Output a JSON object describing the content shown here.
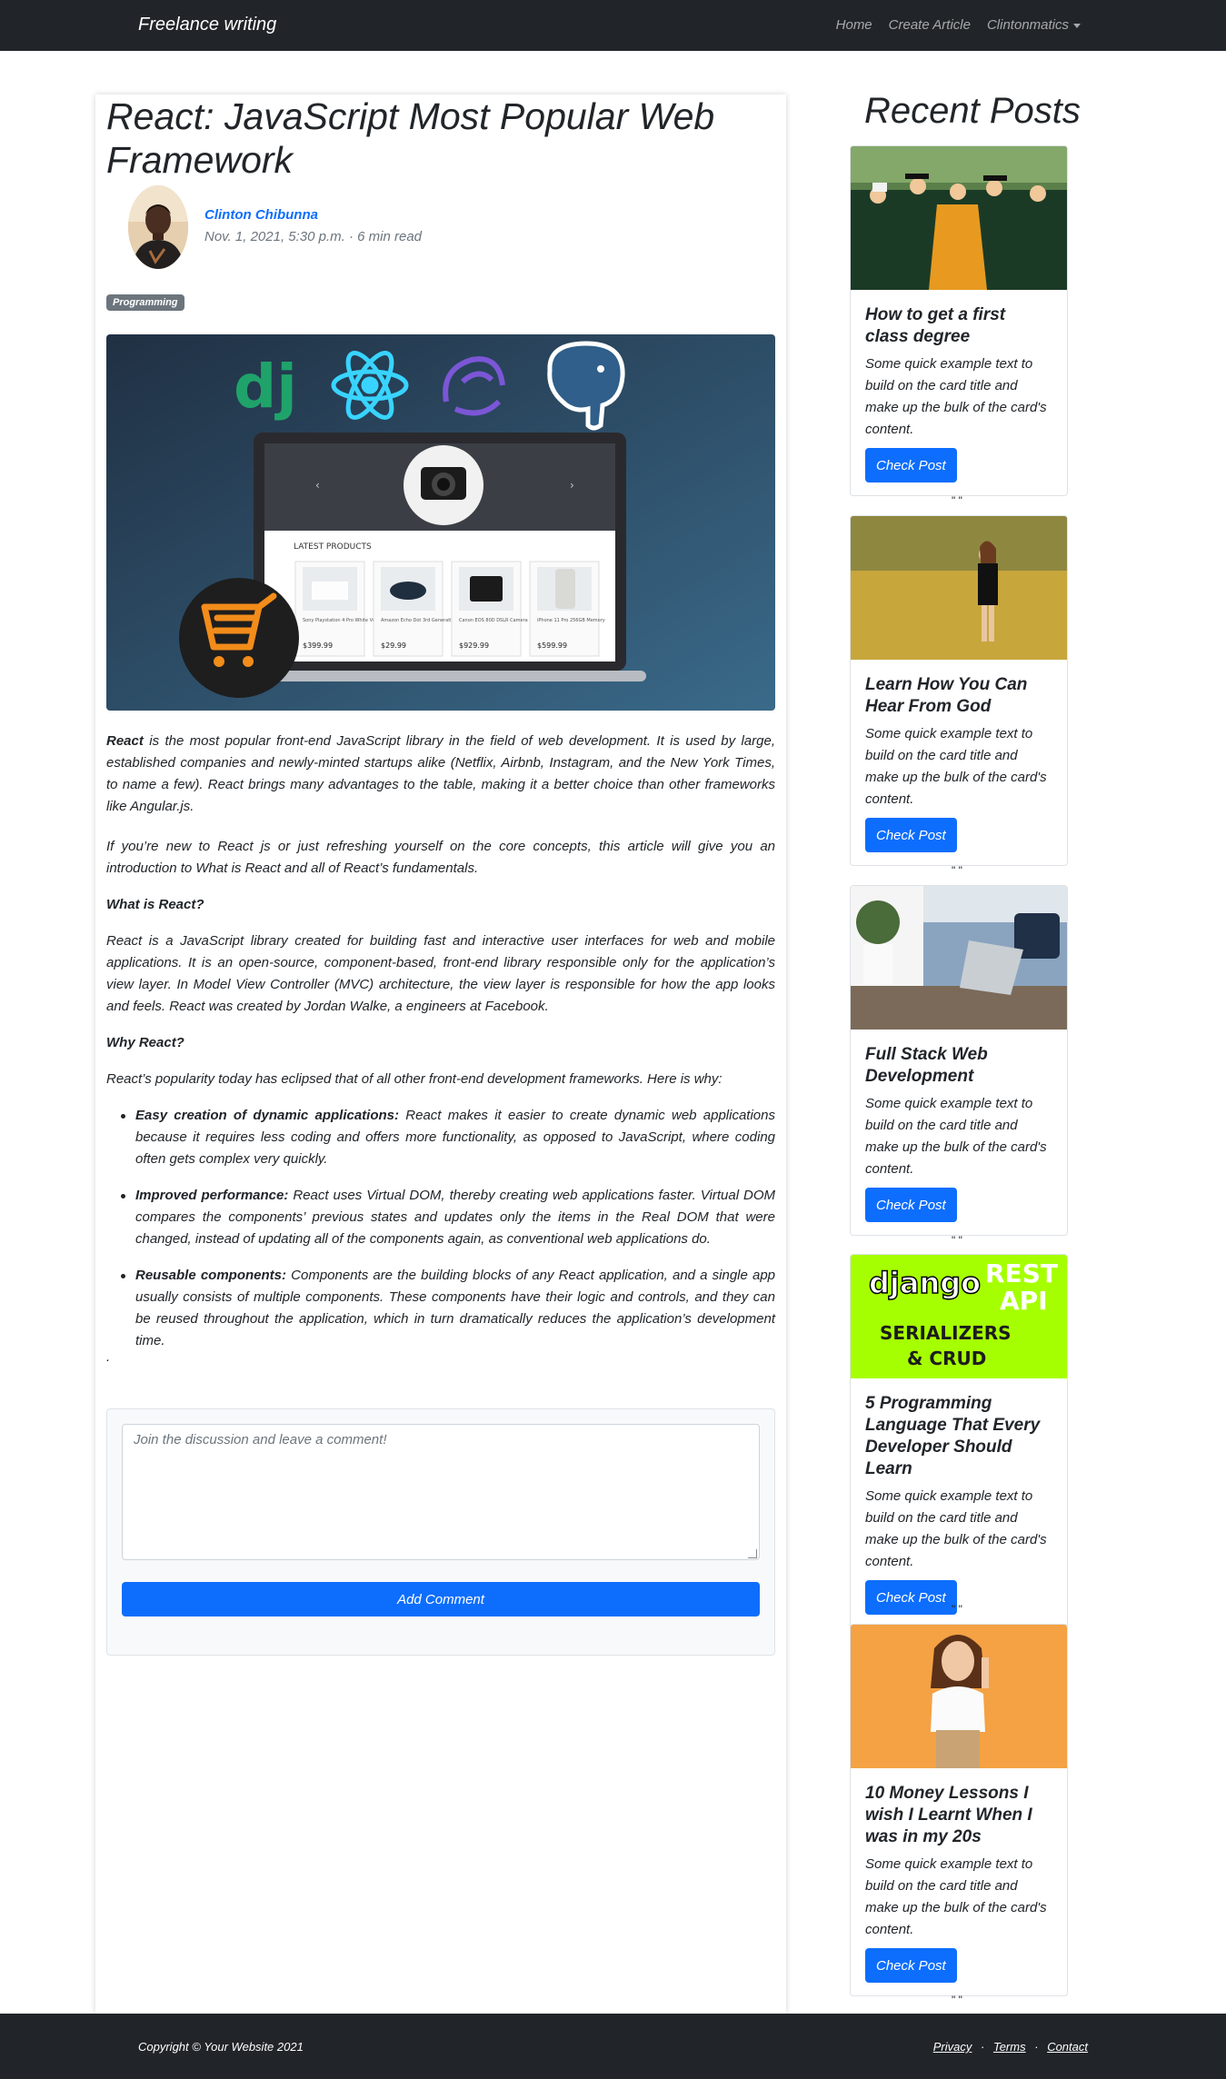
{
  "nav": {
    "brand": "Freelance writing",
    "links": [
      "Home",
      "Create Article",
      "Clintonmatics"
    ]
  },
  "article": {
    "title": "React: JavaScript Most Popular Web Framework",
    "author": "Clinton Chibunna",
    "meta": "Nov. 1, 2021, 5:30 p.m. · 6 min read",
    "category": "Programming",
    "p1_lead": "React",
    "p1_rest": " is the most popular front-end JavaScript library in the field of web development. It is used by large, established companies and newly-minted startups alike (Netflix, Airbnb, Instagram, and the New York Times, to name a few). React brings many advantages to the table, making it a better choice than other frameworks like Angular.js.",
    "p2": "If you’re new to React js or just refreshing yourself on the core concepts, this article will give you an introduction to What is React and all of React’s fundamentals.",
    "h_what": "What is React?",
    "p3": "React is a JavaScript library created for building fast and interactive user interfaces for web and mobile applications. It is an open-source, component-based, front-end library responsible only for the application’s view layer. In Model View Controller (MVC) architecture, the view layer is responsible for how the app looks and feels. React was created by Jordan Walke, a engineers  at Facebook.",
    "h_why": "Why React?",
    "p4": "React’s popularity today has eclipsed that of all other front-end development frameworks. Here is why:",
    "list": [
      {
        "lead": "Easy creation of dynamic applications:",
        "text": " React makes it easier to create dynamic web applications because it requires less coding and offers more functionality, as opposed to JavaScript, where coding often gets complex very quickly."
      },
      {
        "lead": "Improved performance:",
        "text": " React uses Virtual DOM, thereby creating web applications faster. Virtual DOM compares the components’ previous states and updates only the items in the Real DOM that were changed, instead of updating all of the components again, as conventional web applications do."
      },
      {
        "lead": "Reusable components:",
        "text": " Components are the building blocks of any React application, and a single app usually consists of multiple components. These components have their logic and controls, and they can be reused throughout the application, which in turn dramatically reduces the application’s development time."
      }
    ],
    "trailing_dot": "."
  },
  "hero_image": {
    "section_label": "LATEST PRODUCTS",
    "products": [
      {
        "name": "Sony Playstation 4 Pro White Version",
        "price": "$399.99"
      },
      {
        "name": "Amazon Echo Dot 3rd Generation",
        "price": "$29.99"
      },
      {
        "name": "Canon EOS 80D DSLR Camera",
        "price": "$929.99"
      },
      {
        "name": "iPhone 11 Pro 256GB Memory",
        "price": "$599.99"
      }
    ]
  },
  "comment": {
    "placeholder": "Join the discussion and leave a comment!",
    "button": "Add Comment"
  },
  "sidebar": {
    "title": "Recent Posts",
    "posts": [
      {
        "title": "How to get a first class degree",
        "text": "Some quick example text to build on the card title and make up the bulk of the card's content.",
        "button": "Check Post"
      },
      {
        "title": "Learn How You Can Hear From God",
        "text": "Some quick example text to build on the card title and make up the bulk of the card's content.",
        "button": "Check Post"
      },
      {
        "title": "Full Stack Web Development",
        "text": "Some quick example text to build on the card title and make up the bulk of the card's content.",
        "button": "Check Post"
      },
      {
        "title": "5 Programming Language That Every Developer Should Learn",
        "text": "Some quick example text to build on the card title and make up the bulk of the card's content.",
        "button": "Check Post"
      },
      {
        "title": "10 Money Lessons I wish I Learnt When I was in my 20s",
        "text": "Some quick example text to build on the card title and make up the bulk of the card's content.",
        "button": "Check Post"
      }
    ],
    "separator": "\" \"",
    "django_banner": {
      "brand": "django",
      "rest": "REST",
      "api": "API",
      "line1": "SERIALIZERS",
      "line2": "& CRUD"
    }
  },
  "footer": {
    "copyright": "Copyright © Your Website 2021",
    "links": [
      "Privacy",
      "Terms",
      "Contact"
    ],
    "separator": "·"
  },
  "colors": {
    "navbar": "#212529",
    "primary": "#0d6efd",
    "badge": "#6c757d",
    "django_green": "#a6ff00"
  }
}
